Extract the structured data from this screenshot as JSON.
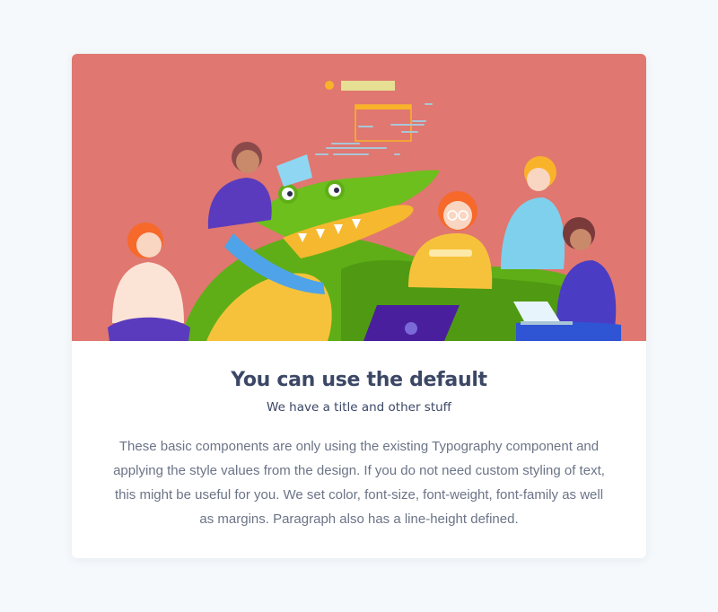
{
  "card": {
    "title": "You can use the default",
    "subtitle": "We have a title and other stuff",
    "paragraph": "These basic components are only using the existing Typography component and applying the style values from the design. If you do not need custom styling of text, this might be useful for you. We set color, font-size, font-weight, font-family as well as margins. Paragraph also has a line-height defined."
  },
  "illustration": {
    "icon": "team-with-crocodile-illustration",
    "background_color": "#e07770"
  },
  "colors": {
    "page_background": "#f5f9fc",
    "card_background": "#ffffff",
    "title_color": "#3c4766",
    "paragraph_color": "#6b7487"
  }
}
